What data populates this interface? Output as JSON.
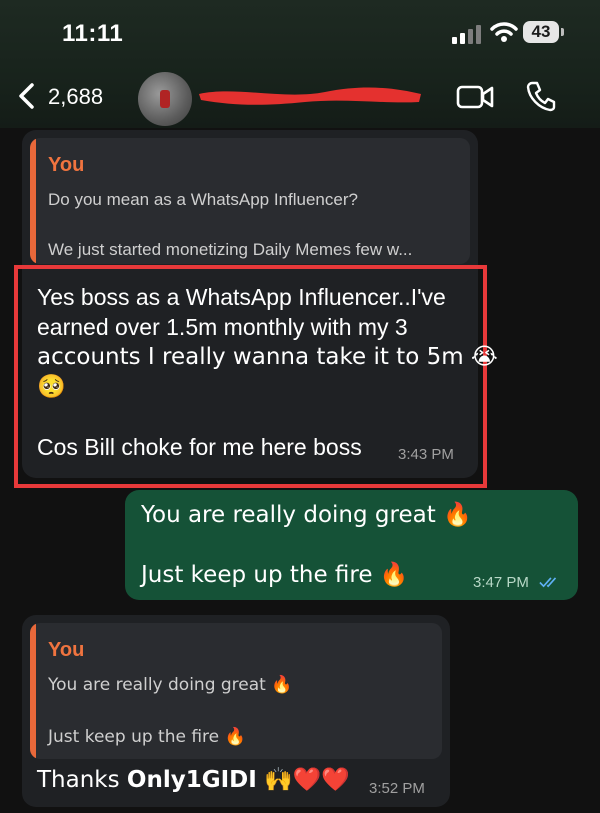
{
  "status_bar": {
    "time": "11:11",
    "battery": "43"
  },
  "header": {
    "back_count": "2,688"
  },
  "messages": [
    {
      "quote_author": "You",
      "quote_line1": "Do you mean as a WhatsApp Influencer?",
      "quote_line2": "We just started monetizing Daily Memes few w...",
      "line1": "Yes boss as a WhatsApp Influencer..I've",
      "line2": "earned over 1.5m monthly with my 3",
      "line3": "accounts I really wanna take it to 5m 😭",
      "line4": "🥺",
      "line5": "Cos Bill choke for me here boss",
      "time": "3:43 PM"
    },
    {
      "line1": "You are really doing great 🔥",
      "line2": "Just keep up the fire 🔥",
      "time": "3:47 PM"
    },
    {
      "quote_author": "You",
      "quote_line1": "You are really doing great 🔥",
      "quote_line2": "Just keep up the fire 🔥",
      "text_prefix": "Thanks ",
      "text_name": "Only1GIDI",
      "text_emoji": " 🙌❤️❤️",
      "time": "3:52 PM"
    }
  ],
  "colors": {
    "accent": "#e8683a",
    "outgoing": "#155237",
    "incoming": "#1f2124",
    "highlight": "#e8393a"
  },
  "icons": [
    "back-chevron-icon",
    "video-call-icon",
    "phone-call-icon",
    "double-check-icon"
  ]
}
